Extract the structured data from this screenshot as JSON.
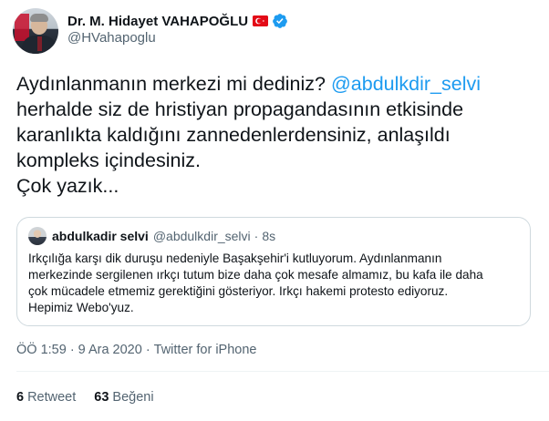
{
  "author": {
    "display_name": "Dr. M. Hidayet VAHAPOĞLU",
    "handle": "@HVahapoglu",
    "flag_icon": "turkey-flag-icon",
    "verified_icon": "verified-badge-icon",
    "verified_color": "#1d9bf0"
  },
  "tweet": {
    "lines": [
      {
        "before": "Aydınlanmanın merkezi mi dediniz? ",
        "mention": "@abdulkdir_selvi",
        "after": ""
      },
      {
        "before": "herhalde siz de hristiyan propagandasının etkisinde",
        "mention": "",
        "after": ""
      },
      {
        "before": "karanlıkta kaldığını zannedenlerdensiniz, anlaşıldı",
        "mention": "",
        "after": ""
      },
      {
        "before": "kompleks içindesiniz.",
        "mention": "",
        "after": ""
      },
      {
        "before": "Çok yazık...",
        "mention": "",
        "after": ""
      }
    ]
  },
  "quote": {
    "name": "abdulkadir selvi",
    "handle": "@abdulkdir_selvi",
    "dot": "·",
    "time": "8s",
    "lines": [
      "Irkçılığa karşı dik duruşu nedeniyle Başakşehir'i kutluyorum. Aydınlanmanın",
      "merkezinde sergilenen ırkçı tutum bize daha çok mesafe almamız, bu kafa ile daha",
      "çok mücadele etmemiz gerektiğini gösteriyor. Irkçı hakemi protesto ediyoruz.",
      "Hepimiz Webo'yuz."
    ]
  },
  "meta": {
    "time": "ÖÖ 1:59",
    "date": "9 Ara 2020",
    "source": "Twitter for iPhone",
    "sep": "·"
  },
  "stats": {
    "retweets_count": "6",
    "retweets_label": "Retweet",
    "likes_count": "63",
    "likes_label": "Beğeni"
  },
  "colors": {
    "accent": "#1d9bf0",
    "text": "#0f1419",
    "secondary": "#536471",
    "border": "#cfd9de",
    "flag_red": "#e30a17"
  }
}
